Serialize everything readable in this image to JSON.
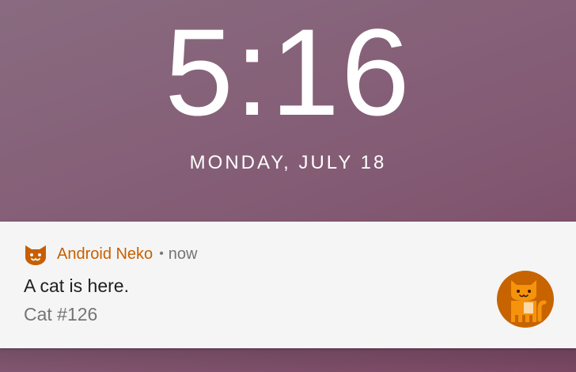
{
  "lockscreen": {
    "clock": "5:16",
    "date": "MONDAY, JULY 18"
  },
  "notification": {
    "app_icon": "cat-face-icon",
    "app_name": "Android Neko",
    "separator": "•",
    "time": "now",
    "title": "A cat is here.",
    "text": "Cat #126",
    "large_icon": "cat-avatar-icon",
    "colors": {
      "accent": "#c75f00",
      "cat_orange": "#f6930c",
      "avatar_bg": "#c76400"
    }
  }
}
